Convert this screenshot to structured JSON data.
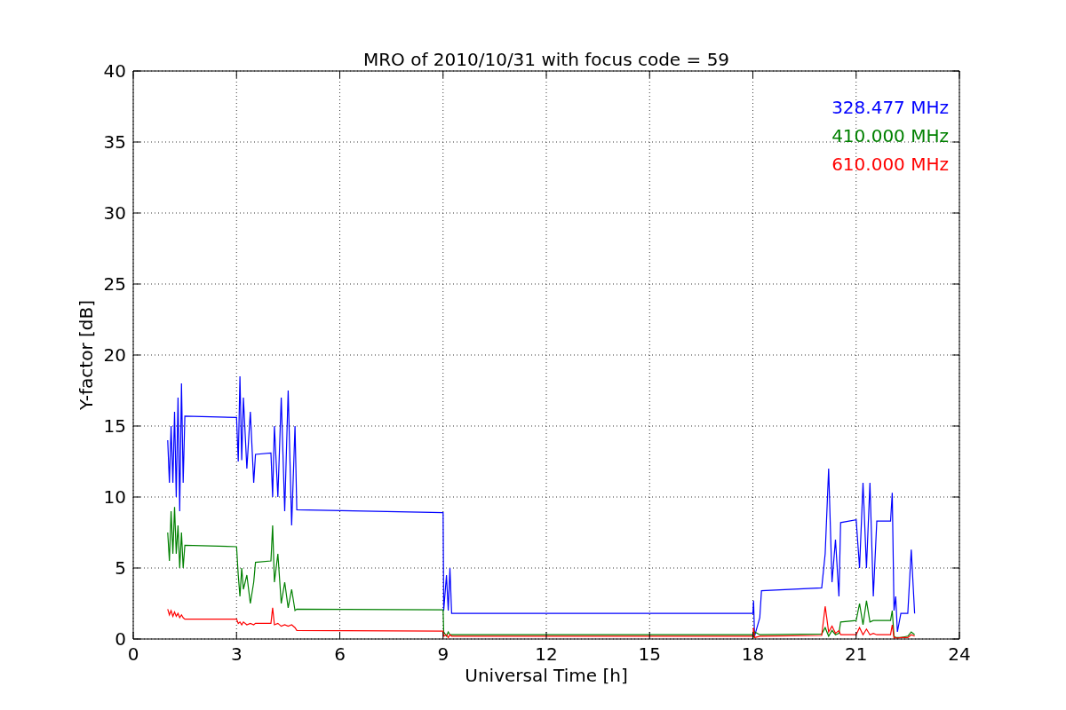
{
  "chart_data": {
    "type": "line",
    "title": "MRO of 2010/10/31 with focus code = 59",
    "xlabel": "Universal Time [h]",
    "ylabel": "Y-factor [dB]",
    "x": [
      1.0,
      1.05,
      1.1,
      1.15,
      1.2,
      1.25,
      1.3,
      1.35,
      1.4,
      1.45,
      1.5,
      3.0,
      3.05,
      3.1,
      3.15,
      3.2,
      3.3,
      3.4,
      3.5,
      3.55,
      4.0,
      4.05,
      4.1,
      4.2,
      4.3,
      4.4,
      4.5,
      4.6,
      4.7,
      4.75,
      9.0,
      9.02,
      9.1,
      9.15,
      9.2,
      9.25,
      18.0,
      18.02,
      18.05,
      18.2,
      18.25,
      20.0,
      20.1,
      20.2,
      20.3,
      20.4,
      20.5,
      20.55,
      21.0,
      21.1,
      21.2,
      21.3,
      21.4,
      21.5,
      21.6,
      22.0,
      22.05,
      22.1,
      22.15,
      22.2,
      22.3,
      22.5,
      22.6,
      22.7
    ],
    "series": [
      {
        "name": "328.477 MHz",
        "color": "#0000ff",
        "values": [
          14,
          11,
          15,
          11,
          16,
          10,
          17,
          9,
          18,
          11,
          15.7,
          15.6,
          12.5,
          18.5,
          12.6,
          17,
          12,
          16,
          11,
          13,
          13.1,
          10,
          15,
          10,
          17,
          9,
          17.5,
          8,
          15,
          9.1,
          8.9,
          2,
          4.5,
          2,
          5,
          1.8,
          1.8,
          2.7,
          0.2,
          1.5,
          3.4,
          3.6,
          6,
          12,
          4,
          7,
          3,
          8.2,
          8.4,
          5,
          11,
          5,
          11,
          3,
          8.3,
          8.3,
          10.3,
          2,
          3,
          0.5,
          1.8,
          1.8,
          6.3,
          1.8
        ]
      },
      {
        "name": "410.000 MHz",
        "color": "#008000",
        "values": [
          7.5,
          5.5,
          9,
          6,
          9.3,
          6,
          8,
          5,
          7.5,
          5,
          6.6,
          6.5,
          4.5,
          3,
          5,
          3.5,
          4.5,
          2.5,
          4,
          5.4,
          5.5,
          8,
          4,
          6,
          2.5,
          4,
          2.2,
          3.5,
          2,
          2.1,
          2.05,
          0.5,
          0.2,
          0.5,
          0.3,
          0.3,
          0.3,
          0.1,
          0.5,
          0.3,
          0.3,
          0.35,
          0.8,
          0.2,
          0.6,
          0.3,
          0.4,
          1.2,
          1.3,
          2.5,
          1,
          2.7,
          1.2,
          1.3,
          1.3,
          1.3,
          2,
          0.2,
          0.1,
          0.1,
          0.1,
          0.2,
          0.5,
          0.3
        ]
      },
      {
        "name": "610.000 MHz",
        "color": "#ff0000",
        "values": [
          2.1,
          1.7,
          2,
          1.6,
          1.9,
          1.6,
          1.8,
          1.5,
          1.7,
          1.5,
          1.4,
          1.4,
          1.1,
          1.2,
          1,
          1.2,
          1,
          1.1,
          1,
          1.1,
          1.1,
          2.2,
          1,
          1.1,
          0.9,
          1,
          0.9,
          1,
          0.8,
          0.6,
          0.55,
          0.2,
          0.3,
          0.1,
          0.3,
          0.2,
          0.2,
          0.8,
          0.1,
          0.2,
          0.2,
          0.25,
          2.3,
          0.5,
          0.9,
          0.4,
          0.6,
          0.3,
          0.3,
          0.8,
          0.3,
          0.7,
          0.3,
          0.4,
          0.3,
          0.3,
          1,
          0.05,
          0.1,
          0.05,
          0.1,
          0.1,
          0.3,
          0.2
        ]
      }
    ],
    "grid": true,
    "xlim": [
      0,
      24
    ],
    "ylim": [
      0,
      40
    ],
    "xticks": [
      0,
      3,
      6,
      9,
      12,
      15,
      18,
      21,
      24
    ],
    "yticks": [
      0,
      5,
      10,
      15,
      20,
      25,
      30,
      35,
      40
    ]
  }
}
